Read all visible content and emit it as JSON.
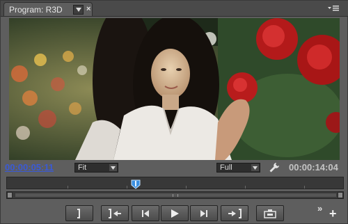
{
  "panel": {
    "tab_title": "Program: R3D",
    "close_symbol": "×"
  },
  "timecode": {
    "current": "00:00:05:11",
    "duration": "00:00:14:04"
  },
  "zoom_select": {
    "value": "Fit"
  },
  "resolution_select": {
    "value": "Full"
  },
  "playhead_position_fraction": 0.38,
  "icons": {
    "tab_dropdown": "chevron-down-icon",
    "panel_menu": "panel-menu-icon",
    "settings": "wrench-icon",
    "more": "overflow-icon",
    "add": "plus-icon"
  },
  "transport": {
    "more_label": "»",
    "add_label": "+"
  },
  "colors": {
    "current_timecode": "#3a5ad6",
    "duration_timecode": "#c4c4c4",
    "panel_bg": "#5e5e5e"
  }
}
